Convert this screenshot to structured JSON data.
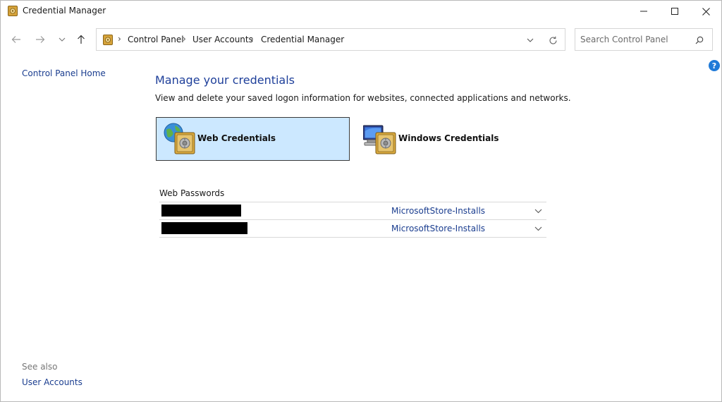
{
  "window": {
    "title": "Credential Manager",
    "minimize_glyph": "—",
    "maximize_glyph": "□",
    "close_glyph": "✕"
  },
  "address": {
    "crumbs": [
      "Control Panel",
      "User Accounts",
      "Credential Manager"
    ],
    "separator": "›"
  },
  "search": {
    "placeholder": "Search Control Panel",
    "value": ""
  },
  "help": {
    "glyph": "?"
  },
  "left_pane": {
    "home_link": "Control Panel Home",
    "see_also_label": "See also",
    "see_also_links": [
      "User Accounts"
    ]
  },
  "main": {
    "heading": "Manage your credentials",
    "description": "View and delete your saved logon information for websites, connected applications and networks.",
    "tabs": [
      {
        "label": "Web Credentials",
        "icon": "globe-vault-icon",
        "selected": true
      },
      {
        "label": "Windows Credentials",
        "icon": "computer-vault-icon",
        "selected": false
      }
    ],
    "section_title": "Web Passwords",
    "entries": [
      {
        "name": "[redacted]",
        "source": "MicrosoftStore-Installs"
      },
      {
        "name": "[redacted]",
        "source": "MicrosoftStore-Installs"
      }
    ]
  },
  "colors": {
    "accent_heading": "#1e3f9a",
    "link": "#1a3d8f",
    "selected_tile_bg": "#cce8ff",
    "help_blue": "#1f7ad8"
  }
}
